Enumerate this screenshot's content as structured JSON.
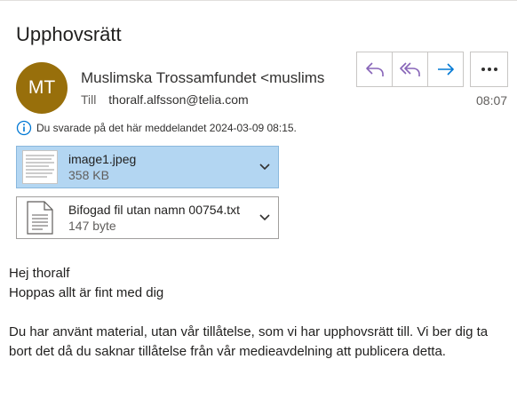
{
  "subject": "Upphovsrätt",
  "sender": {
    "initials": "MT",
    "avatar_color": "#986f0b",
    "display": "Muslimska Trossamfundet <muslimska.trossamfundet",
    "to_label": "Till",
    "to_address": "thoralf.alfsson@telia.com",
    "time": "08:07"
  },
  "actions": {
    "reply_icon": "reply-icon",
    "reply_all_icon": "reply-all-icon",
    "forward_icon": "forward-icon",
    "more_icon": "more-icon",
    "accent": "#8764b8",
    "forward_accent": "#0078d4"
  },
  "replied_notice": "Du svarade på det här meddelandet 2024-03-09 08:15.",
  "attachments": [
    {
      "name": "image1.jpeg",
      "size": "358 KB",
      "selected": true
    },
    {
      "name": "Bifogad fil utan namn 00754.txt",
      "size": "147 byte",
      "selected": false
    }
  ],
  "body": {
    "greeting": "Hej thoralf",
    "line2": "Hoppas allt är fint med dig",
    "paragraph": "Du har använt material, utan vår tillåtelse, som vi har upphovsrätt till. Vi ber dig ta bort det då du saknar tillåtelse från vår medieavdelning att publicera detta."
  }
}
